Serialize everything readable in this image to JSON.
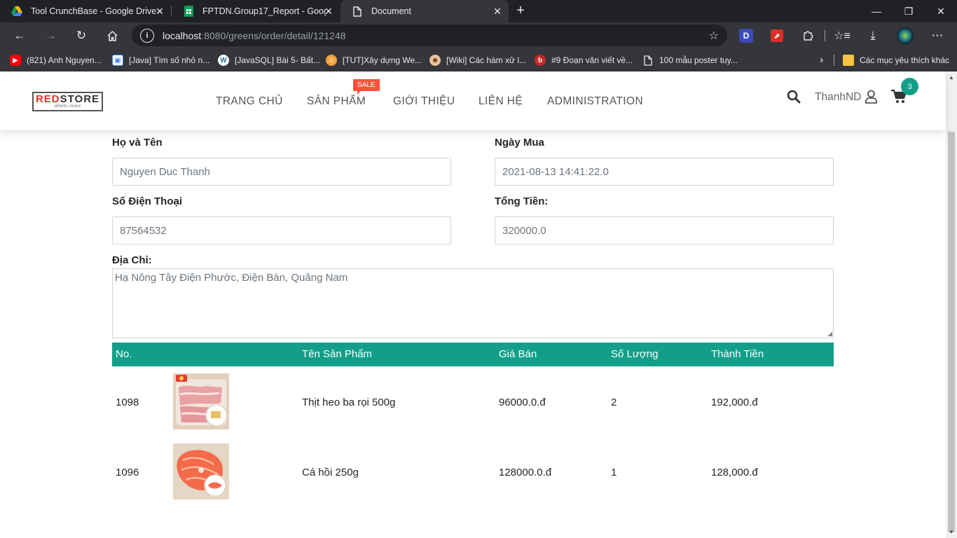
{
  "browser": {
    "tabs": [
      {
        "title": "Tool CrunchBase - Google Drive",
        "icon": "google-drive-icon"
      },
      {
        "title": "FPTDN.Group17_Report - Google",
        "icon": "google-sheets-icon"
      },
      {
        "title": "Document",
        "icon": "document-icon"
      }
    ],
    "url_host": "localhost",
    "url_path": ":8080/greens/order/detail/121248",
    "bookmarks": [
      {
        "label": "(821) Anh Nguyen...",
        "icon": "youtube-icon"
      },
      {
        "label": "[Java] Tìm số nhỏ n...",
        "icon": "bookmark-icon"
      },
      {
        "label": "[JavaSQL] Bài 5- Bất...",
        "icon": "wordpress-icon"
      },
      {
        "label": "[TUT]Xây dựng We...",
        "icon": "forum-icon"
      },
      {
        "label": "[Wiki] Các hàm xử l...",
        "icon": "avatar-icon"
      },
      {
        "label": "#9 Đoạn văn viết về...",
        "icon": "blog-icon"
      },
      {
        "label": "100 mẫu poster tuy...",
        "icon": "page-icon"
      }
    ],
    "other_bookmarks": "Các mục yêu thích khác",
    "profile_letter": "D"
  },
  "site": {
    "logo_red": "RED",
    "logo_dark": "STORE",
    "logo_tagline": "athletic choice",
    "nav": [
      "TRANG CHỦ",
      "SẢN PHẨM",
      "GIỚI THIỆU",
      "LIÊN HỆ",
      "ADMINISTRATION"
    ],
    "sale_badge": "SALE",
    "username": "ThanhND",
    "cart_count": "3"
  },
  "form": {
    "name_label": "Họ và Tên",
    "name_value": "Nguyen Duc Thanh",
    "date_label": "Ngày Mua",
    "date_value": "2021-08-13 14:41:22.0",
    "phone_label": "Số Điện Thoại",
    "phone_value": "87564532",
    "total_label": "Tổng Tiền:",
    "total_value": "320000.0",
    "address_label": "Địa Chỉ:",
    "address_value": "Hạ Nông Tây Điện Phước, Điện Bàn, Quảng Nam"
  },
  "table": {
    "headers": [
      "No.",
      "Tên Sản Phẩm",
      "Giá Bán",
      "Số Lượng",
      "Thành Tiền"
    ],
    "rows": [
      {
        "no": "1098",
        "name": "Thịt heo ba rọi 500g",
        "price": "96000.0.đ",
        "qty": "2",
        "subtotal": "192,000.đ",
        "image": "pork-belly-image"
      },
      {
        "no": "1096",
        "name": "Cá hồi 250g",
        "price": "128000.0.đ",
        "qty": "1",
        "subtotal": "128,000.đ",
        "image": "salmon-steak-image"
      }
    ]
  },
  "colors": {
    "accent": "#139e8a",
    "sale": "#ff523b",
    "logo_red": "#e2322c"
  }
}
